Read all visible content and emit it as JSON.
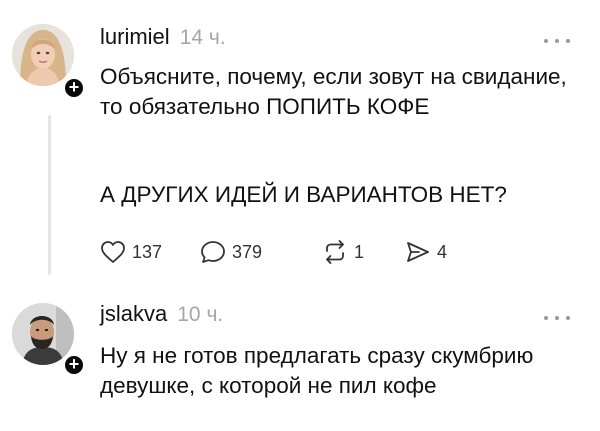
{
  "posts": [
    {
      "username": "lurimiel",
      "time": "14 ч.",
      "paragraphs": [
        "Объясните, почему, если зовут на свидание, то обязательно ПОПИТЬ КОФЕ",
        "А ДРУГИХ ИДЕЙ И ВАРИАНТОВ НЕТ?"
      ],
      "stats": {
        "likes": "137",
        "comments": "379",
        "reposts": "1",
        "shares": "4"
      },
      "avatar_icon": "avatar-woman",
      "follow_badge": "+"
    },
    {
      "username": "jslakva",
      "time": "10 ч.",
      "paragraphs": [
        "Ну я не готов предлагать сразу скумбрию девушке, с которой не пил кофе"
      ],
      "avatar_icon": "avatar-man",
      "follow_badge": "+"
    }
  ],
  "icons": [
    "more-icon",
    "heart-icon",
    "comment-icon",
    "repost-icon",
    "share-icon",
    "plus-icon"
  ],
  "colors": {
    "text": "#111111",
    "muted": "#a6a6a6",
    "icon": "#333333",
    "thread_line": "#e5e5e5",
    "badge": "#0a0a0a"
  }
}
